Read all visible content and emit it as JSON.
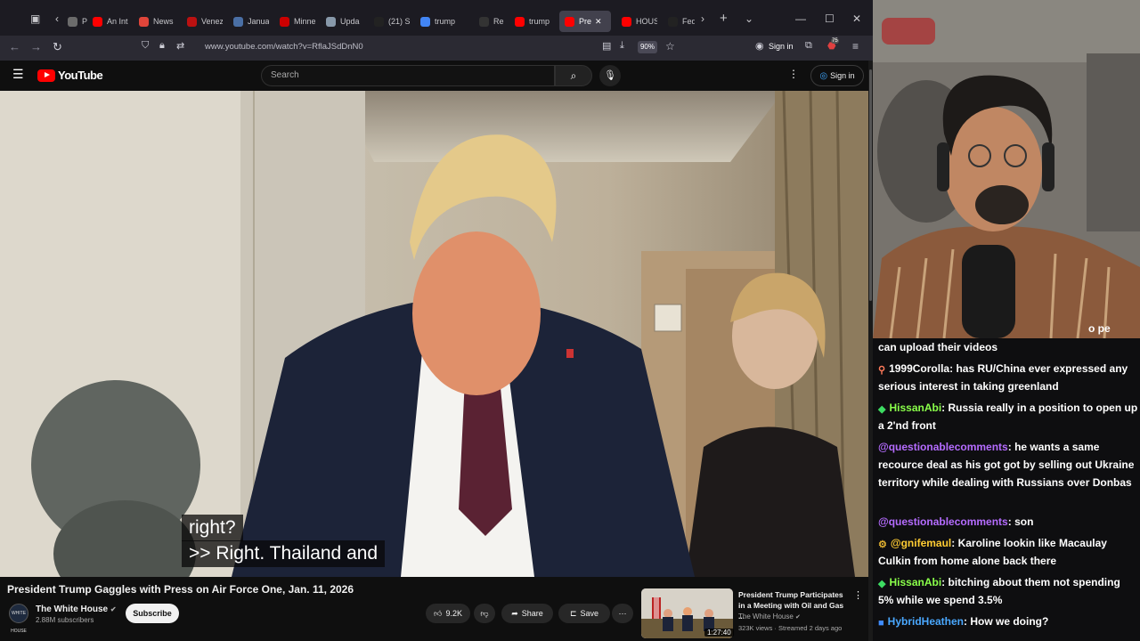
{
  "browser": {
    "tabs": [
      {
        "label": "Pu",
        "color": "#6b6b6b"
      },
      {
        "label": "An Int",
        "color": "#ff0000"
      },
      {
        "label": "News",
        "color": "#e0453a"
      },
      {
        "label": "Venez",
        "color": "#b11"
      },
      {
        "label": "Janua",
        "color": "#4a6fa5"
      },
      {
        "label": "Minne",
        "color": "#cc0000"
      },
      {
        "label": "Upda",
        "color": "#8899aa"
      },
      {
        "label": "(21) S",
        "color": "#222"
      },
      {
        "label": "trump",
        "color": "#4285f4"
      },
      {
        "label": "Remo",
        "color": "#333"
      },
      {
        "label": "trump",
        "color": "#ff0000"
      },
      {
        "label": "Pre",
        "color": "#ff0000"
      },
      {
        "label": "HOUS",
        "color": "#ff0000"
      },
      {
        "label": "Fed",
        "color": "#222"
      }
    ],
    "url": "www.youtube.com/watch?v=RflaJSdDnN0",
    "zoom": "90%",
    "signin_label": "Sign in",
    "extension_badge": "75"
  },
  "youtube": {
    "logo_text": "YouTube",
    "search_placeholder": "Search",
    "signin_label": "Sign in"
  },
  "video": {
    "caption_line1": "right?",
    "caption_line2": ">> Right. Thailand and",
    "title": "President Trump Gaggles with Press on Air Force One, Jan. 11, 2026",
    "channel_name": "The White House",
    "channel_avatar_text": "WHITE HOUSE",
    "subscribers": "2.88M subscribers",
    "subscribe_label": "Subscribe",
    "likes": "9.2K",
    "share_label": "Share",
    "save_label": "Save"
  },
  "recommendation": {
    "title": "President Trump Participates in a Meeting with Oil and Gas ...",
    "channel": "The White House",
    "meta": "323K views · Streamed 2 days ago",
    "duration": "1:27:40"
  },
  "stream": {
    "webcam_text": "o pe",
    "chat": [
      {
        "user": "",
        "text": "can upload their videos",
        "user_color": "#ffffff",
        "badge": ""
      },
      {
        "user": "1999Corolla",
        "text": ": has RU/China ever expressed any serious interest in taking greenland",
        "user_color": "#ffffff",
        "badge": "user"
      },
      {
        "user": "HissanAbi",
        "text": ": Russia really in a position to open up a 2'nd front",
        "user_color": "#8aff4a",
        "badge": "diamond"
      },
      {
        "user": "@questionablecomments",
        "text": ": he wants a same recource deal as his got got by selling out Ukraine territory while dealing with Russians over Donbas",
        "user_color": "#b56cff",
        "badge": ""
      },
      {
        "user": "@questionablecomments",
        "text": ": son",
        "user_color": "#b56cff",
        "badge": ""
      },
      {
        "user": "@gnifemaul",
        "text": ": Karoline lookin like Macaulay Culkin from home alone back there",
        "user_color": "#ffcc33",
        "badge": "gear"
      },
      {
        "user": "HissanAbi",
        "text": ": bitching about them not spending 5% while we spend 3.5%",
        "user_color": "#8aff4a",
        "badge": "diamond"
      },
      {
        "user": "HybridHeathen",
        "text": ": How we doing?",
        "user_color": "#4aa8ff",
        "badge": "square"
      }
    ]
  }
}
